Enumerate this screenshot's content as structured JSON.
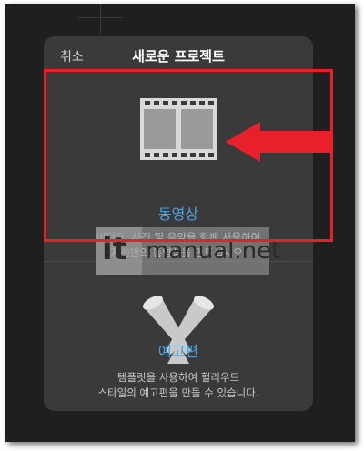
{
  "header": {
    "cancel_label": "취소",
    "title": "새로운 프로젝트"
  },
  "options": {
    "video": {
      "label": "동영상",
      "description": [
        "비디오, 사진 및 음악을 함께 사용하여",
        "자신만의 동영상을 만드십시오."
      ]
    },
    "trailer": {
      "label": "예고편",
      "description": [
        "템플릿을 사용하여 헐리우드",
        "스타일의 예고편을 만들 수 있습니다."
      ]
    }
  },
  "watermark": {
    "logo": "it",
    "text": "manual.net"
  },
  "colors": {
    "accent": "#4aa3e0",
    "annotation_red": "#e8202a",
    "sheet_background": "#3a3a3a"
  },
  "icons": {
    "film": "film-strip-icon",
    "trailer": "spotlights-icon",
    "annotation": "red-arrow-icon"
  }
}
